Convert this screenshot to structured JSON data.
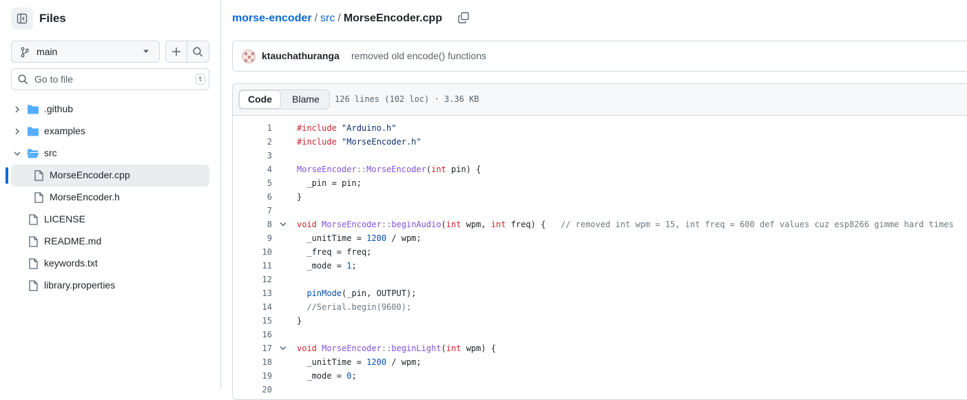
{
  "sidebar": {
    "title": "Files",
    "branch": "main",
    "goto_placeholder": "Go to file",
    "goto_shortcut": "t",
    "tree": [
      {
        "name": ".github",
        "type": "folder",
        "expanded": false
      },
      {
        "name": "examples",
        "type": "folder",
        "expanded": false
      },
      {
        "name": "src",
        "type": "folder",
        "expanded": true
      },
      {
        "name": "MorseEncoder.cpp",
        "type": "file",
        "selected": true
      },
      {
        "name": "MorseEncoder.h",
        "type": "file"
      },
      {
        "name": "LICENSE",
        "type": "file"
      },
      {
        "name": "README.md",
        "type": "file"
      },
      {
        "name": "keywords.txt",
        "type": "file"
      },
      {
        "name": "library.properties",
        "type": "file"
      }
    ]
  },
  "breadcrumb": {
    "repo": "morse-encoder",
    "sep1": "/",
    "dir": "src",
    "sep2": "/",
    "file": "MorseEncoder.cpp"
  },
  "commit": {
    "author": "ktauchathuranga",
    "message": "removed old encode() functions"
  },
  "viewer": {
    "tab_code": "Code",
    "tab_blame": "Blame",
    "file_info": "126 lines (102 loc) · 3.36 KB"
  },
  "colors": {
    "link": "#0969da",
    "keyword": "#cf222e",
    "string": "#0a3069",
    "function": "#8250df",
    "number": "#0550ae",
    "comment": "#6e7781"
  },
  "code_lines": [
    {
      "n": "1",
      "t": [
        [
          "k",
          "#include"
        ],
        [
          "p",
          " "
        ],
        [
          "s",
          "\"Arduino.h\""
        ]
      ]
    },
    {
      "n": "2",
      "t": [
        [
          "k",
          "#include"
        ],
        [
          "p",
          " "
        ],
        [
          "s",
          "\"MorseEncoder.h\""
        ]
      ]
    },
    {
      "n": "3",
      "t": []
    },
    {
      "n": "4",
      "t": [
        [
          "f",
          "MorseEncoder"
        ],
        [
          "c",
          "::"
        ],
        [
          "f",
          "MorseEncoder"
        ],
        [
          "p",
          "("
        ],
        [
          "k",
          "int"
        ],
        [
          "p",
          " pin) {"
        ]
      ]
    },
    {
      "n": "5",
      "t": [
        [
          "p",
          "  _pin = pin;"
        ]
      ]
    },
    {
      "n": "6",
      "t": [
        [
          "p",
          "}"
        ]
      ]
    },
    {
      "n": "7",
      "t": []
    },
    {
      "n": "8",
      "fold": true,
      "t": [
        [
          "k",
          "void"
        ],
        [
          "p",
          " "
        ],
        [
          "f",
          "MorseEncoder"
        ],
        [
          "c",
          "::"
        ],
        [
          "f",
          "beginAudio"
        ],
        [
          "p",
          "("
        ],
        [
          "k",
          "int"
        ],
        [
          "p",
          " wpm, "
        ],
        [
          "k",
          "int"
        ],
        [
          "p",
          " freq) {   "
        ],
        [
          "c",
          "// removed int wpm = 15, int freq = 600 def values cuz esp8266 gimme hard times"
        ]
      ]
    },
    {
      "n": "9",
      "t": [
        [
          "p",
          "  _unitTime = "
        ],
        [
          "n",
          "1200"
        ],
        [
          "p",
          " / wpm;"
        ]
      ]
    },
    {
      "n": "10",
      "t": [
        [
          "p",
          "  _freq = freq;"
        ]
      ]
    },
    {
      "n": "11",
      "t": [
        [
          "p",
          "  _mode = "
        ],
        [
          "n",
          "1"
        ],
        [
          "p",
          ";"
        ]
      ]
    },
    {
      "n": "12",
      "t": []
    },
    {
      "n": "13",
      "t": [
        [
          "p",
          "  "
        ],
        [
          "n",
          "pinMode"
        ],
        [
          "p",
          "(_pin, OUTPUT);"
        ]
      ]
    },
    {
      "n": "14",
      "t": [
        [
          "p",
          "  "
        ],
        [
          "c",
          "//Serial.begin(9600);"
        ]
      ]
    },
    {
      "n": "15",
      "t": [
        [
          "p",
          "}"
        ]
      ]
    },
    {
      "n": "16",
      "t": []
    },
    {
      "n": "17",
      "fold": true,
      "t": [
        [
          "k",
          "void"
        ],
        [
          "p",
          " "
        ],
        [
          "f",
          "MorseEncoder"
        ],
        [
          "c",
          "::"
        ],
        [
          "f",
          "beginLight"
        ],
        [
          "p",
          "("
        ],
        [
          "k",
          "int"
        ],
        [
          "p",
          " wpm) {"
        ]
      ]
    },
    {
      "n": "18",
      "t": [
        [
          "p",
          "  _unitTime = "
        ],
        [
          "n",
          "1200"
        ],
        [
          "p",
          " / wpm;"
        ]
      ]
    },
    {
      "n": "19",
      "t": [
        [
          "p",
          "  _mode = "
        ],
        [
          "n",
          "0"
        ],
        [
          "p",
          ";"
        ]
      ]
    },
    {
      "n": "20",
      "t": []
    }
  ]
}
